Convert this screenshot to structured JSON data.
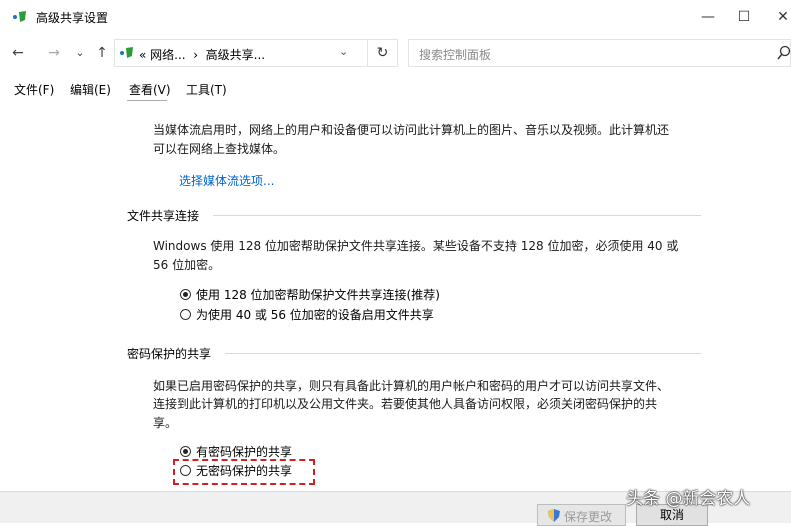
{
  "window": {
    "title": "高级共享设置",
    "minimize_glyph": "—",
    "maximize_glyph": "☐",
    "close_glyph": "✕"
  },
  "nav": {
    "back_glyph": "←",
    "forward_glyph": "→",
    "recent_glyph": "⌄",
    "up_glyph": "↑",
    "breadcrumb": "« 网络...  ›  高级共享...",
    "dropdown_glyph": "⌄",
    "refresh_glyph": "↻",
    "search_placeholder": "搜索控制面板"
  },
  "menu": {
    "items": [
      "文件(F)",
      "编辑(E)",
      "查看(V)",
      "工具(T)"
    ]
  },
  "content": {
    "media_desc_line1": "当媒体流启用时，网络上的用户和设备便可以访问此计算机上的图片、音乐以及视频。此计算机还",
    "media_desc_line2": "可以在网络上查找媒体。",
    "media_link": "选择媒体流选项...",
    "file_sharing": {
      "title": "文件共享连接",
      "desc_line1": "Windows 使用 128 位加密帮助保护文件共享连接。某些设备不支持 128 位加密，必须使用 40 或",
      "desc_line2": "56 位加密。",
      "option1": "使用 128 位加密帮助保护文件共享连接(推荐)",
      "option2": "为使用 40 或 56 位加密的设备启用文件共享"
    },
    "password_sharing": {
      "title": "密码保护的共享",
      "desc_line1": "如果已启用密码保护的共享，则只有具备此计算机的用户帐户和密码的用户才可以访问共享文件、",
      "desc_line2": "连接到此计算机的打印机以及公用文件夹。若要使其他人具备访问权限，必须关闭密码保护的共",
      "desc_line3": "享。",
      "option1": "有密码保护的共享",
      "option2": "无密码保护的共享"
    }
  },
  "buttons": {
    "save": "保存更改",
    "cancel": "取消"
  },
  "watermark": "头条 @新会农人",
  "colors": {
    "link": "#0066cc",
    "highlight_border": "#d42020",
    "icon_green": "#2e9b3a",
    "icon_blue": "#1a73c9"
  }
}
